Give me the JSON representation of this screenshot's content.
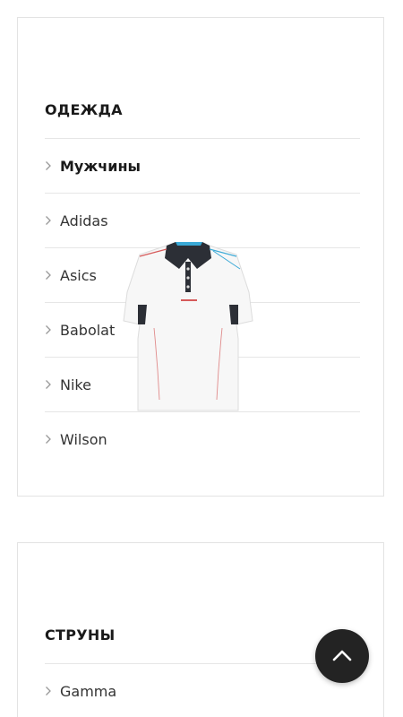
{
  "clothing": {
    "title": "ОДЕЖДА",
    "items": [
      {
        "label": "Мужчины",
        "active": true
      },
      {
        "label": "Adidas"
      },
      {
        "label": "Asics"
      },
      {
        "label": "Babolat"
      },
      {
        "label": "Nike"
      },
      {
        "label": "Wilson"
      }
    ]
  },
  "strings": {
    "title": "СТРУНЫ",
    "items": [
      {
        "label": "Gamma"
      }
    ]
  },
  "icons": {
    "list_chevron": "chevron-right-icon",
    "scroll_top": "chevron-up-icon"
  },
  "colors": {
    "scroll_top_bg": "#232323",
    "divider": "#e6e6e6"
  }
}
